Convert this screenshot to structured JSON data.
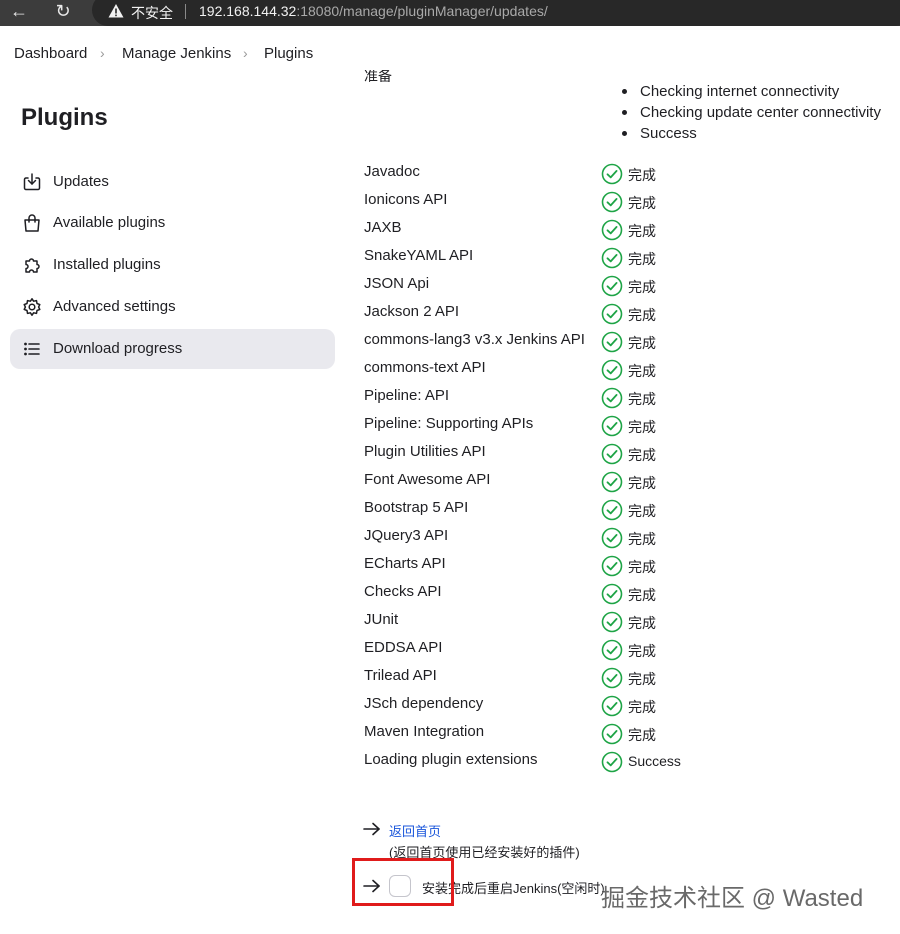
{
  "browser": {
    "security_label": "不安全",
    "url_host": "192.168.144.32",
    "url_rest": ":18080/manage/pluginManager/updates/"
  },
  "breadcrumb": [
    "Dashboard",
    "Manage Jenkins",
    "Plugins"
  ],
  "sidebar": {
    "title": "Plugins",
    "items": [
      {
        "label": "Updates",
        "icon": "download-icon",
        "active": false
      },
      {
        "label": "Available plugins",
        "icon": "shopping-bag-icon",
        "active": false
      },
      {
        "label": "Installed plugins",
        "icon": "puzzle-icon",
        "active": false
      },
      {
        "label": "Advanced settings",
        "icon": "gear-icon",
        "active": false
      },
      {
        "label": "Download progress",
        "icon": "list-icon",
        "active": true
      }
    ]
  },
  "main": {
    "preparation_label": "准备",
    "preparation_checks": [
      "Checking internet connectivity",
      "Checking update center connectivity",
      "Success"
    ],
    "plugins": [
      {
        "name": "Javadoc",
        "status": "完成"
      },
      {
        "name": "Ionicons API",
        "status": "完成"
      },
      {
        "name": "JAXB",
        "status": "完成"
      },
      {
        "name": "SnakeYAML API",
        "status": "完成"
      },
      {
        "name": "JSON Api",
        "status": "完成"
      },
      {
        "name": "Jackson 2 API",
        "status": "完成"
      },
      {
        "name": "commons-lang3 v3.x Jenkins API",
        "status": "完成"
      },
      {
        "name": "commons-text API",
        "status": "完成"
      },
      {
        "name": "Pipeline: API",
        "status": "完成"
      },
      {
        "name": "Pipeline: Supporting APIs",
        "status": "完成"
      },
      {
        "name": "Plugin Utilities API",
        "status": "完成"
      },
      {
        "name": "Font Awesome API",
        "status": "完成"
      },
      {
        "name": "Bootstrap 5 API",
        "status": "完成"
      },
      {
        "name": "JQuery3 API",
        "status": "完成"
      },
      {
        "name": "ECharts API",
        "status": "完成"
      },
      {
        "name": "Checks API",
        "status": "完成"
      },
      {
        "name": "JUnit",
        "status": "完成"
      },
      {
        "name": "EDDSA API",
        "status": "完成"
      },
      {
        "name": "Trilead API",
        "status": "完成"
      },
      {
        "name": "JSch dependency",
        "status": "完成"
      },
      {
        "name": "Maven Integration",
        "status": "完成"
      },
      {
        "name": "Loading plugin extensions",
        "status": "Success"
      }
    ],
    "home_link": "返回首页",
    "home_note": "(返回首页使用已经安装好的插件)",
    "restart_label": "安装完成后重启Jenkins(空闲时)",
    "restart_checked": false
  },
  "watermark": "掘金技术社区 @ Wasted",
  "colors": {
    "success": "#1ea446",
    "link": "#1a56db",
    "highlight": "#e01b1b"
  }
}
